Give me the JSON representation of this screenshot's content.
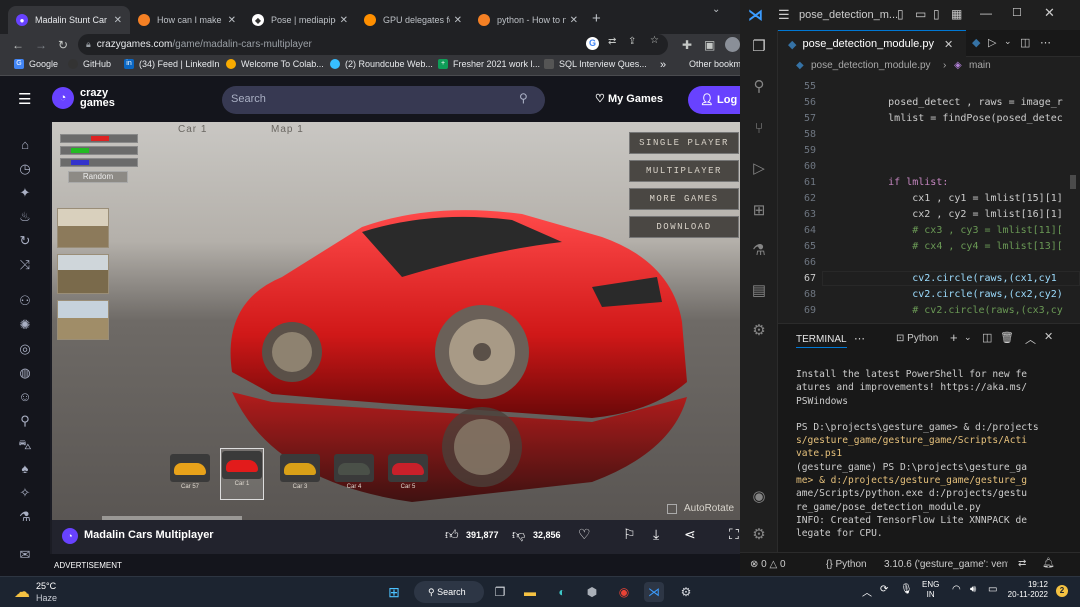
{
  "browser": {
    "tabs": [
      {
        "title": "Madalin Stunt Car",
        "favicon": "crazygames-icon",
        "color": "#6842ff"
      },
      {
        "title": "How can I make a",
        "favicon": "stackoverflow-icon",
        "color": "#f48024"
      },
      {
        "title": "Pose | mediapipe",
        "favicon": "mediapipe-icon",
        "color": "#ffffff"
      },
      {
        "title": "GPU delegates for",
        "favicon": "tensorflow-icon",
        "color": "#ff8f00"
      },
      {
        "title": "python - How to n",
        "favicon": "stackoverflow-icon",
        "color": "#f48024"
      }
    ],
    "address": {
      "domain": "crazygames.com",
      "path": "/game/madalin-cars-multiplayer"
    },
    "bookmarks": [
      {
        "label": "Google",
        "icon": "google-icon",
        "color": "#4285f4"
      },
      {
        "label": "GitHub",
        "icon": "github-icon",
        "color": "#333333"
      },
      {
        "label": "(34) Feed | LinkedIn",
        "icon": "linkedin-icon",
        "color": "#0a66c2"
      },
      {
        "label": "Welcome To Colab...",
        "icon": "colab-icon",
        "color": "#f9ab00"
      },
      {
        "label": "(2) Roundcube Web...",
        "icon": "roundcube-icon",
        "color": "#37beff"
      },
      {
        "label": "Fresher 2021 work l...",
        "icon": "sheets-icon",
        "color": "#0f9d58"
      },
      {
        "label": "SQL Interview Ques...",
        "icon": "sql-icon",
        "color": "#555555"
      },
      {
        "label": "Other bookm",
        "icon": "folder-icon",
        "color": "#e8a33d"
      }
    ],
    "more_bookmarks": "»"
  },
  "crazygames": {
    "logo_line1": "crazy",
    "logo_line2": "games",
    "search_placeholder": "Search",
    "my_games": "My Games",
    "login": "Log",
    "accent": "#6842ff",
    "game": {
      "top_labels": [
        "Car 1",
        "Map 1"
      ],
      "random": "Random",
      "menu": [
        "SINGLE PLAYER",
        "MULTIPLAYER",
        "MORE GAMES",
        "DOWNLOAD"
      ],
      "cars": [
        "Car 57",
        "Car 1",
        "Car 3",
        "Car 4",
        "Car 5"
      ],
      "selected_car": "Car 1",
      "autorotate": "AutoRotate"
    },
    "title": "Madalin Cars Multiplayer",
    "likes": "391,877",
    "dislikes": "32,856",
    "advertisement": "ADVERTISEMENT"
  },
  "vscode": {
    "title": "pose_detection_m...",
    "tab": "pose_detection_module.py",
    "breadcrumb": [
      "pose_detection_module.py",
      "main"
    ],
    "lines": [
      {
        "n": "55",
        "code": ""
      },
      {
        "n": "56",
        "code": "        posed_detect , raws = image_r"
      },
      {
        "n": "57",
        "code": "        lmlist = findPose(posed_detec"
      },
      {
        "n": "58",
        "code": ""
      },
      {
        "n": "59",
        "code": ""
      },
      {
        "n": "60",
        "code": ""
      },
      {
        "n": "61",
        "code": "        if lmlist:"
      },
      {
        "n": "62",
        "code": "            cx1 , cy1 = lmlist[15][1]"
      },
      {
        "n": "63",
        "code": "            cx2 , cy2 = lmlist[16][1]"
      },
      {
        "n": "64",
        "code": "            # cx3 , cy3 = lmlist[11]["
      },
      {
        "n": "65",
        "code": "            # cx4 , cy4 = lmlist[13]["
      },
      {
        "n": "66",
        "code": ""
      },
      {
        "n": "67",
        "code": "            cv2.circle(raws,(cx1,cy1"
      },
      {
        "n": "68",
        "code": "            cv2.circle(raws,(cx2,cy2)"
      },
      {
        "n": "69",
        "code": "            # cv2.circle(raws,(cx3,cy"
      }
    ],
    "current_line": "67",
    "panel_tab": "TERMINAL",
    "terminal_shell": "Python",
    "terminal": [
      {
        "t": "Install the latest PowerShell for new fe",
        "c": "#cccccc"
      },
      {
        "t": "atures and improvements! https://aka.ms/",
        "c": "#cccccc"
      },
      {
        "t": "PSWindows",
        "c": "#cccccc"
      },
      {
        "t": "",
        "c": "#cccccc"
      },
      {
        "t": "PS D:\\projects\\gesture_game> & d:/projects",
        "c": "#cccccc"
      },
      {
        "t": "s/gesture_game/gesture_game/Scripts/Acti",
        "c": "#e5c07b"
      },
      {
        "t": "vate.ps1",
        "c": "#e5c07b"
      },
      {
        "t": "(gesture_game) PS D:\\projects\\gesture_ga",
        "c": "#cccccc"
      },
      {
        "t": "me> & d:/projects/gesture_game/gesture_g",
        "c": "#e5c07b"
      },
      {
        "t": "ame/Scripts/python.exe d:/projects/gestu",
        "c": "#cccccc"
      },
      {
        "t": "re_game/pose_detection_module.py",
        "c": "#cccccc"
      },
      {
        "t": "INFO: Created TensorFlow Lite XNNPACK de",
        "c": "#cccccc"
      },
      {
        "t": "legate for CPU.",
        "c": "#cccccc"
      }
    ],
    "status": {
      "errors": "0",
      "warnings": "0",
      "language": "Python",
      "interpreter": "3.10.6 ('gesture_game': venv"
    }
  },
  "taskbar": {
    "weather_temp": "25°C",
    "weather_desc": "Haze",
    "search": "Search",
    "lang1": "ENG",
    "lang2": "IN",
    "time": "19:12",
    "date": "20-11-2022",
    "notifications": "2"
  }
}
